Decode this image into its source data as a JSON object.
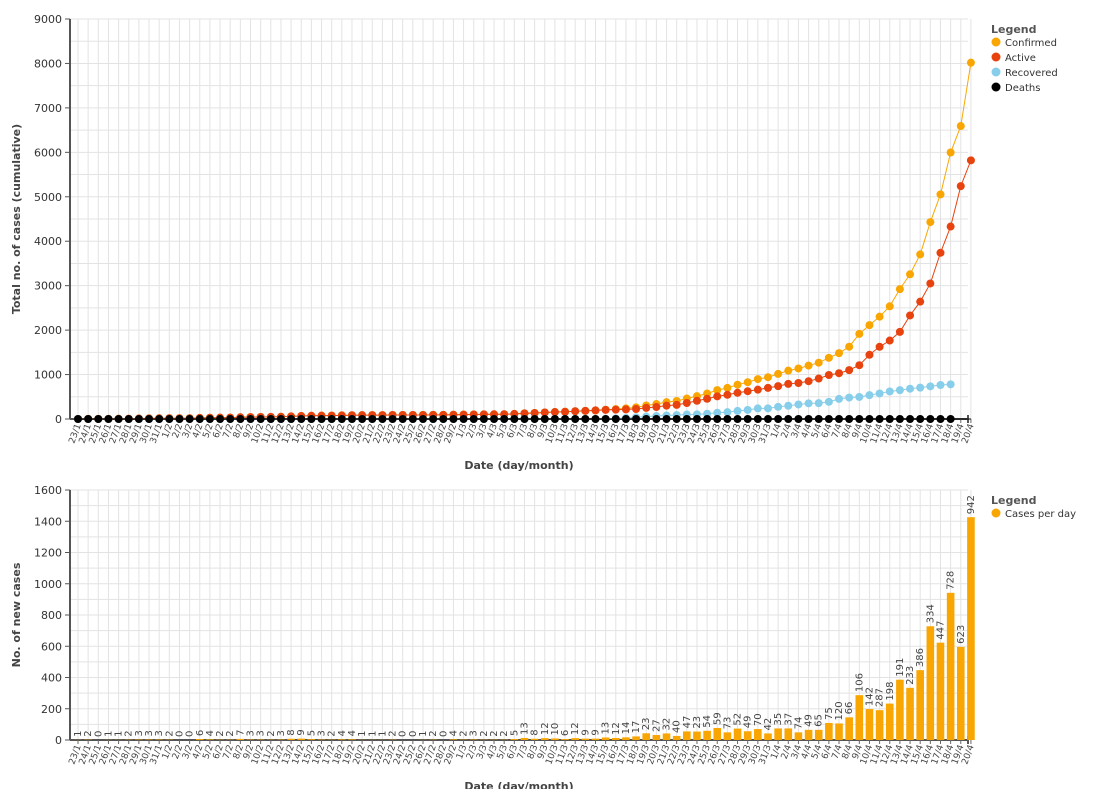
{
  "chart_data": [
    {
      "type": "line",
      "title": "",
      "xlabel": "Date (day/month)",
      "ylabel": "Total no. of cases (cumulative)",
      "ylim": [
        0,
        9000
      ],
      "yticks": [
        0,
        1000,
        2000,
        3000,
        4000,
        5000,
        6000,
        7000,
        8000,
        9000
      ],
      "grid": true,
      "legend_position": "top-right",
      "legend_title": "Legend",
      "x": [
        "23/1",
        "24/1",
        "25/1",
        "26/1",
        "27/1",
        "28/1",
        "29/1",
        "30/1",
        "31/1",
        "1/2",
        "2/2",
        "3/2",
        "4/2",
        "5/2",
        "6/2",
        "7/2",
        "8/2",
        "9/2",
        "10/2",
        "11/2",
        "12/2",
        "13/2",
        "14/2",
        "15/2",
        "16/2",
        "17/2",
        "18/2",
        "19/2",
        "20/2",
        "21/2",
        "22/2",
        "23/2",
        "24/2",
        "25/2",
        "26/2",
        "27/2",
        "28/2",
        "29/2",
        "1/3",
        "2/3",
        "3/3",
        "4/3",
        "5/3",
        "6/3",
        "7/3",
        "8/3",
        "9/3",
        "10/3",
        "11/3",
        "12/3",
        "13/3",
        "14/3",
        "15/3",
        "16/3",
        "17/3",
        "18/3",
        "19/3",
        "20/3",
        "21/3",
        "22/3",
        "23/3",
        "24/3",
        "25/3",
        "26/3",
        "27/3",
        "28/3",
        "29/3",
        "30/3",
        "31/3",
        "1/4",
        "2/4",
        "3/4",
        "4/4",
        "5/4",
        "6/4",
        "7/4",
        "8/4",
        "9/4",
        "10/4",
        "11/4",
        "12/4",
        "13/4",
        "14/4",
        "15/4",
        "16/4",
        "17/4",
        "18/4",
        "19/4",
        "20/4"
      ],
      "series": [
        {
          "name": "Confirmed",
          "color": "#f9a602",
          "values": [
            1,
            3,
            3,
            4,
            5,
            7,
            10,
            13,
            16,
            18,
            18,
            18,
            24,
            28,
            30,
            32,
            39,
            42,
            45,
            47,
            50,
            58,
            67,
            72,
            75,
            77,
            81,
            85,
            86,
            87,
            88,
            90,
            90,
            90,
            91,
            93,
            93,
            97,
            99,
            102,
            104,
            106,
            108,
            114,
            127,
            135,
            147,
            157,
            163,
            175,
            184,
            193,
            209,
            222,
            239,
            262,
            305,
            337,
            379,
            405,
            460,
            514,
            573,
            650,
            699,
            772,
            828,
            898,
            940,
            1014,
            1088,
            1137,
            1202,
            1267,
            1376,
            1482,
            1627,
            1914,
            2112,
            2303,
            2536,
            2922,
            3256,
            3703,
            4431,
            5054,
            5996,
            6592,
            8018
          ]
        },
        {
          "name": "Active",
          "color": "#e8420f",
          "values": [
            1,
            3,
            3,
            4,
            5,
            7,
            10,
            13,
            16,
            18,
            18,
            18,
            24,
            28,
            30,
            32,
            39,
            42,
            45,
            47,
            50,
            58,
            67,
            72,
            75,
            77,
            81,
            85,
            86,
            87,
            88,
            90,
            90,
            90,
            91,
            93,
            93,
            97,
            99,
            102,
            104,
            106,
            108,
            114,
            127,
            135,
            147,
            157,
            163,
            175,
            184,
            193,
            205,
            210,
            216,
            225,
            250,
            270,
            300,
            318,
            360,
            410,
            455,
            510,
            545,
            590,
            625,
            660,
            700,
            740,
            790,
            810,
            850,
            910,
            990,
            1030,
            1100,
            1210,
            1445,
            1625,
            1765,
            1960,
            2330,
            2640,
            3050,
            3740,
            4330,
            5240,
            5820
          ]
        },
        {
          "name": "Recovered",
          "color": "#87ceeb",
          "values": [
            0,
            0,
            0,
            0,
            0,
            0,
            0,
            0,
            0,
            0,
            0,
            0,
            0,
            0,
            0,
            0,
            0,
            0,
            0,
            0,
            0,
            0,
            0,
            0,
            0,
            0,
            0,
            0,
            0,
            0,
            0,
            0,
            0,
            0,
            0,
            0,
            0,
            0,
            0,
            0,
            0,
            0,
            0,
            0,
            0,
            0,
            0,
            0,
            0,
            0,
            0,
            0,
            4,
            12,
            23,
            37,
            55,
            67,
            79,
            87,
            100,
            104,
            118,
            140,
            154,
            182,
            203,
            238,
            240,
            274,
            298,
            327,
            352,
            357,
            386,
            452,
            482,
            496,
            537,
            575,
            620,
            650,
            682,
            706,
            735,
            765,
            780,
            0,
            0
          ]
        },
        {
          "name": "Deaths",
          "color": "#000000",
          "values": [
            0,
            0,
            0,
            0,
            0,
            0,
            0,
            0,
            0,
            0,
            0,
            0,
            0,
            0,
            0,
            0,
            0,
            0,
            0,
            0,
            0,
            0,
            0,
            0,
            0,
            0,
            0,
            0,
            0,
            0,
            0,
            0,
            0,
            0,
            0,
            0,
            0,
            0,
            0,
            0,
            0,
            0,
            0,
            0,
            0,
            0,
            0,
            0,
            0,
            0,
            0,
            0,
            0,
            0,
            0,
            0,
            0,
            0,
            0,
            0,
            0,
            0,
            0,
            0,
            0,
            0,
            0,
            0,
            0,
            0,
            0,
            0,
            0,
            0,
            0,
            0,
            0,
            0,
            0,
            0,
            0,
            0,
            0,
            0,
            0,
            0,
            0,
            0,
            0
          ]
        }
      ]
    },
    {
      "type": "bar",
      "title": "",
      "xlabel": "Date (day/month)",
      "ylabel": "No. of new cases",
      "ylim": [
        0,
        1600
      ],
      "yticks": [
        0,
        200,
        400,
        600,
        800,
        1000,
        1200,
        1400,
        1600
      ],
      "grid": true,
      "legend_position": "top-right",
      "legend_title": "Legend",
      "x": [
        "23/1",
        "24/1",
        "25/1",
        "26/1",
        "27/1",
        "28/1",
        "29/1",
        "30/1",
        "31/1",
        "1/2",
        "2/2",
        "3/2",
        "4/2",
        "5/2",
        "6/2",
        "7/2",
        "8/2",
        "9/2",
        "10/2",
        "11/2",
        "12/2",
        "13/2",
        "14/2",
        "15/2",
        "16/2",
        "17/2",
        "18/2",
        "19/2",
        "20/2",
        "21/2",
        "22/2",
        "23/2",
        "24/2",
        "25/2",
        "26/2",
        "27/2",
        "28/2",
        "29/2",
        "1/3",
        "2/3",
        "3/3",
        "4/3",
        "5/3",
        "6/3",
        "7/3",
        "8/3",
        "9/3",
        "10/3",
        "11/3",
        "12/3",
        "13/3",
        "14/3",
        "15/3",
        "16/3",
        "17/3",
        "18/3",
        "19/3",
        "20/3",
        "21/3",
        "22/3",
        "23/3",
        "24/3",
        "25/3",
        "26/3",
        "27/3",
        "28/3",
        "29/3",
        "30/3",
        "31/3",
        "1/4",
        "2/4",
        "3/4",
        "4/4",
        "5/4",
        "6/4",
        "7/4",
        "8/4",
        "9/4",
        "10/4",
        "11/4",
        "12/4",
        "13/4",
        "14/4",
        "15/4",
        "16/4",
        "17/4",
        "18/4",
        "19/4",
        "20/4"
      ],
      "series": [
        {
          "name": "Cases per day",
          "color": "#f9a602",
          "values": [
            1,
            2,
            0,
            1,
            1,
            2,
            3,
            3,
            3,
            2,
            0,
            0,
            6,
            4,
            2,
            2,
            7,
            3,
            3,
            2,
            3,
            8,
            9,
            5,
            3,
            2,
            4,
            4,
            1,
            1,
            1,
            2,
            0,
            0,
            1,
            2,
            0,
            4,
            2,
            3,
            2,
            2,
            2,
            6,
            13,
            8,
            12,
            10,
            6,
            12,
            9,
            9,
            16,
            13,
            17,
            23,
            43,
            32,
            42,
            26,
            55,
            54,
            59,
            77,
            49,
            73,
            56,
            70,
            42,
            74,
            74,
            49,
            65,
            65,
            109,
            106,
            145,
            287,
            198,
            191,
            233,
            386,
            334,
            447,
            728,
            623,
            942,
            596,
            1426
          ]
        }
      ],
      "data_labels": [
        "1",
        "2",
        "0",
        "1",
        "1",
        "2",
        "3",
        "3",
        "3",
        "2",
        "0",
        "0",
        "6",
        "4",
        "2",
        "2",
        "7",
        "3",
        "3",
        "2",
        "3",
        "8",
        "9",
        "5",
        "3",
        "2",
        "4",
        "4",
        "1",
        "1",
        "1",
        "2",
        "0",
        "0",
        "1",
        "2",
        "0",
        "4",
        "2",
        "3",
        "2",
        "2",
        "2",
        "5",
        "13",
        "8",
        "12",
        "10",
        "6",
        "12",
        "9",
        "9",
        "13",
        "12",
        "14",
        "17",
        "23",
        "27",
        "32",
        "40",
        "47",
        "23",
        "54",
        "59",
        "73",
        "52",
        "49",
        "70",
        "42",
        "35",
        "37",
        "74",
        "49",
        "65",
        "75",
        "120",
        "66",
        "106",
        "142",
        "287",
        "198",
        "191",
        "233",
        "386",
        "334",
        "447",
        "728",
        "623",
        "942",
        "596",
        "1426"
      ]
    }
  ]
}
